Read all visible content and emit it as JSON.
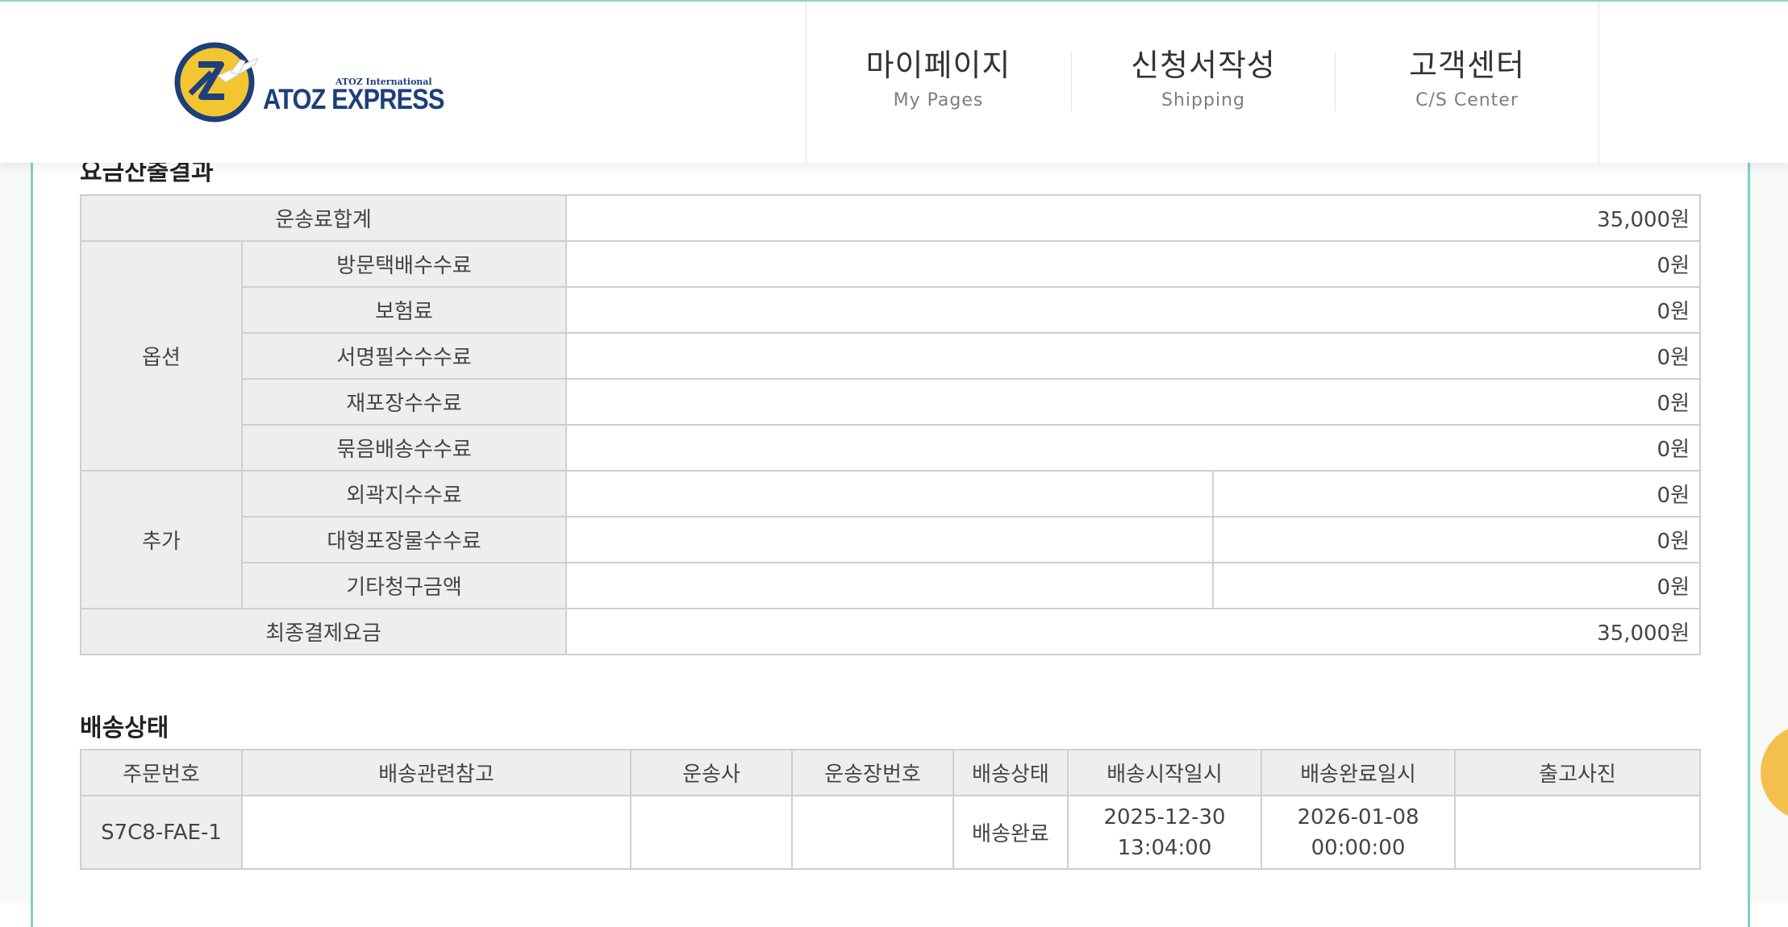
{
  "header": {
    "logo": {
      "subtitle": "ATOZ International",
      "title": "ATOZ EXPRESS",
      "brand_color": "#1d3f7a",
      "accent_color": "#f3c531",
      "icon": "airplane-icon"
    },
    "nav": [
      {
        "label": "마이페이지",
        "sub": "My Pages"
      },
      {
        "label": "신청서작성",
        "sub": "Shipping"
      },
      {
        "label": "고객센터",
        "sub": "C/S Center"
      }
    ]
  },
  "fee_section": {
    "title": "요금산출결과",
    "total_label": "운송료합계",
    "total_value": "35,000원",
    "options": {
      "group_label": "옵션",
      "rows": [
        {
          "label": "방문택배수수료",
          "value": "0원"
        },
        {
          "label": "보험료",
          "value": "0원"
        },
        {
          "label": "서명필수수수료",
          "value": "0원"
        },
        {
          "label": "재포장수수료",
          "value": "0원"
        },
        {
          "label": "묶음배송수수료",
          "value": "0원"
        }
      ]
    },
    "additional": {
      "group_label": "추가",
      "rows": [
        {
          "label": "외곽지수수료",
          "value": "0원"
        },
        {
          "label": "대형포장물수수료",
          "value": "0원"
        },
        {
          "label": "기타청구금액",
          "value": "0원"
        }
      ]
    },
    "final_label": "최종결제요금",
    "final_value": "35,000원"
  },
  "shipping_section": {
    "title": "배송상태",
    "columns": [
      "주문번호",
      "배송관련참고",
      "운송사",
      "운송장번호",
      "배송상태",
      "배송시작일시",
      "배송완료일시",
      "출고사진"
    ],
    "rows": [
      {
        "order_no": "S7C8-FAE-1",
        "note": "",
        "carrier": "",
        "tracking_no": "",
        "status": "배송완료",
        "start_date": "2025-12-30",
        "start_time": "13:04:00",
        "end_date": "2026-01-08",
        "end_time": "00:00:00",
        "photo": ""
      }
    ]
  },
  "colors": {
    "border": "#cfcfcf",
    "header_cell": "#eeeeee",
    "frame_teal": "#7fcfc6",
    "floating_button": "#f3c04d"
  }
}
